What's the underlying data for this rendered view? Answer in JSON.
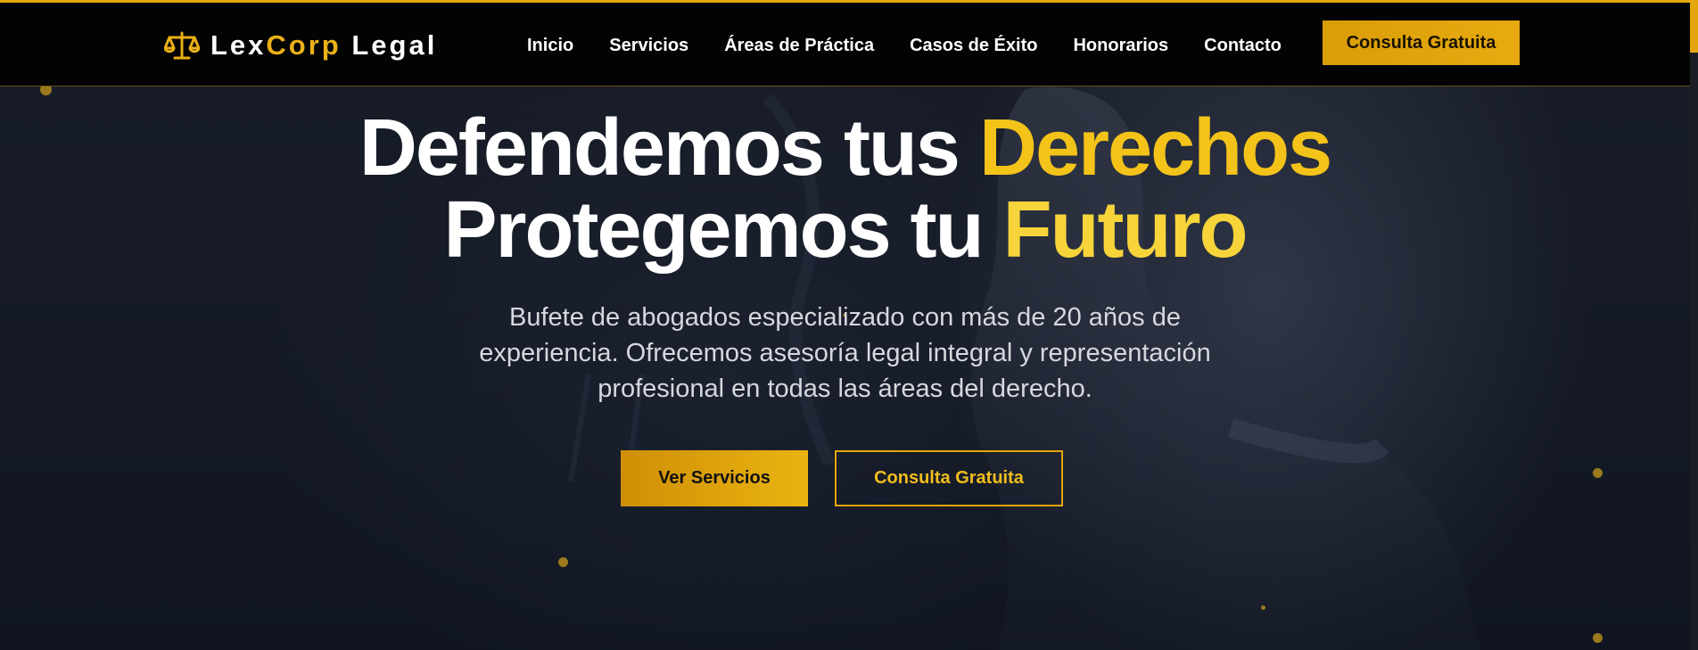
{
  "brand": {
    "name_part1": "Lex",
    "name_part2": "Corp",
    "name_part3": " Legal",
    "icon": "scales-of-justice-icon"
  },
  "nav": {
    "links": [
      "Inicio",
      "Servicios",
      "Áreas de Práctica",
      "Casos de Éxito",
      "Honorarios",
      "Contacto"
    ],
    "cta_label": "Consulta Gratuita"
  },
  "hero": {
    "line1_white": "Defendemos tus ",
    "line1_gold": "Derechos",
    "line2_white": "Protegemos tu ",
    "line2_gold": "Futuro",
    "subtitle": "Bufete de abogados especializado con más de 20 años de experiencia. Ofrecemos asesoría legal integral y representación profesional en todas las áreas del derecho.",
    "primary_button": "Ver Servicios",
    "secondary_button": "Consulta Gratuita"
  },
  "colors": {
    "accent": "#e4a60d",
    "gold_text": "#f4c31a",
    "nav_background": "#030303",
    "hero_background": "#141925"
  }
}
